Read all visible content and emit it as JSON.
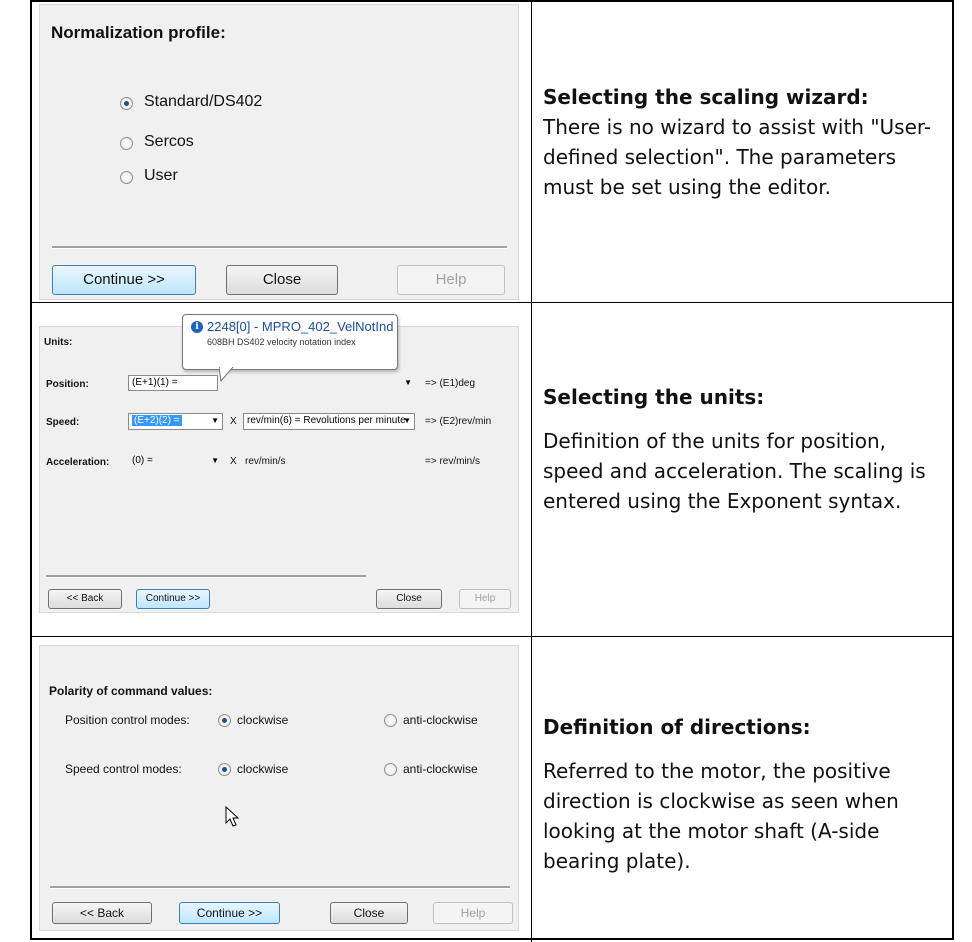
{
  "section1": {
    "dialog": {
      "title": "Normalization profile:",
      "options": [
        {
          "label": "Standard/DS402",
          "checked": true
        },
        {
          "label": "Sercos",
          "checked": false
        },
        {
          "label": "User",
          "checked": false
        }
      ],
      "buttons": {
        "continue": "Continue >>",
        "close": "Close",
        "help": "Help"
      }
    },
    "heading": "Selecting the scaling wizard:",
    "body": "There is no wizard to assist with \"User-defined selection\". The parameters must be set using the editor."
  },
  "section2": {
    "dialog": {
      "title": "Units:",
      "tooltip": {
        "title": "2248[0] - MPRO_402_VelNotInd",
        "subtitle": "608BH DS402 velocity notation index"
      },
      "rows": [
        {
          "label": "Position:",
          "exponent": "(E+1)(1) =",
          "unit": "",
          "result": "=>  (E1)deg"
        },
        {
          "label": "Speed:",
          "exponent": "(E+2)(2) =",
          "unit": "rev/min(6) = Revolutions per minute",
          "result": "=>  (E2)rev/min"
        },
        {
          "label": "Acceleration:",
          "exponent": "(0) =",
          "unit": "rev/min/s",
          "result": "=>  rev/min/s"
        }
      ],
      "x_symbol": "X",
      "buttons": {
        "back": "<< Back",
        "continue": "Continue >>",
        "close": "Close",
        "help": "Help"
      }
    },
    "heading": "Selecting the units:",
    "body": "Definition of the units for position, speed and acceleration. The scaling is entered using the Exponent syntax."
  },
  "section3": {
    "dialog": {
      "title": "Polarity of command values:",
      "rows": [
        {
          "label": "Position control modes:",
          "option_a": "clockwise",
          "option_b": "anti-clockwise",
          "selected": "a"
        },
        {
          "label": "Speed control modes:",
          "option_a": "clockwise",
          "option_b": "anti-clockwise",
          "selected": "a"
        }
      ],
      "buttons": {
        "back": "<< Back",
        "continue": "Continue >>",
        "close": "Close",
        "help": "Help"
      }
    },
    "heading": "Definition of directions:",
    "body": "Referred to the motor, the positive direction is clockwise as seen when looking at the motor shaft (A-side bearing plate)."
  }
}
